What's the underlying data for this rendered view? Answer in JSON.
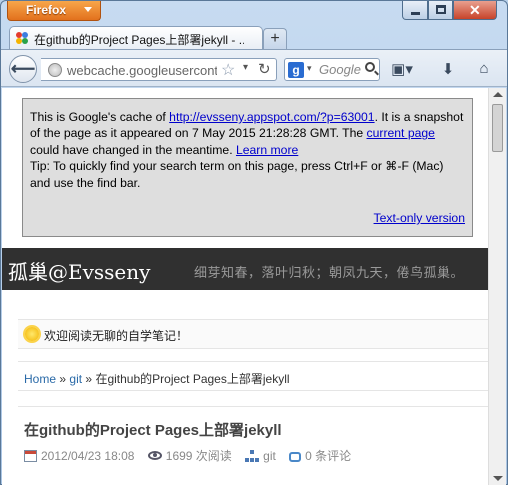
{
  "browser": {
    "app_button": "Firefox",
    "tab_title": "在github的Project Pages上部署jekyll - ...",
    "new_tab": "+",
    "url": "webcache.googleusercontent.com/search?q=cache",
    "search_placeholder": "Google",
    "search_engine_icon": "google-g",
    "window_close_glyph": "✕"
  },
  "cache_notice": {
    "intro": "This is Google's cache of ",
    "cached_url": "http://evsseny.appspot.com/?p=63001",
    "sentence_rest": ". It is a snapshot of the page as it appeared on 7 May 2015 21:28:28 GMT. The ",
    "current_page_link": "current page",
    "changed_text": " could have changed in the meantime. ",
    "learn_more_link": "Learn more",
    "tip": "Tip: To quickly find your search term on this page, press Ctrl+F or ⌘-F (Mac) and use the find bar.",
    "text_only_link": "Text-only version"
  },
  "blog": {
    "title": "孤巢@Evsseny",
    "description": "细芽知春，落叶归秋；朝凤九天，倦鸟孤巢。",
    "welcome": "欢迎阅读无聊的自学笔记！",
    "breadcrumb": {
      "home": "Home",
      "sep": "»",
      "category": "git",
      "current": "在github的Project Pages上部署jekyll"
    },
    "post": {
      "title": "在github的Project Pages上部署jekyll",
      "date": "2012/04/23 18:08",
      "views": "1699 次阅读",
      "category": "git",
      "comments": "0 条评论"
    }
  },
  "colors": {
    "header_bg": "#303030",
    "link": "#0000cc",
    "firefox_orange": "#e2711d"
  }
}
